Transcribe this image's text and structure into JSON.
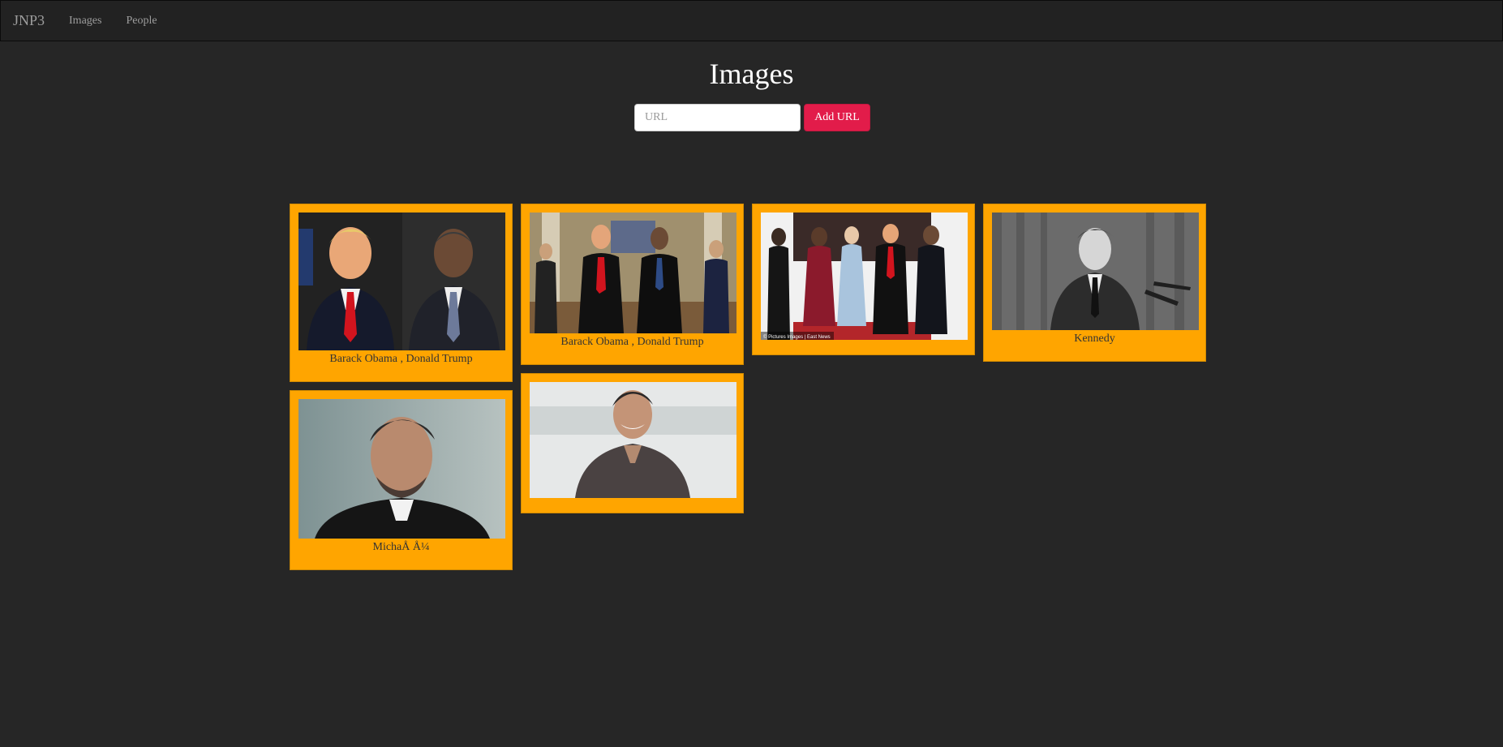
{
  "nav": {
    "brand": "JNP3",
    "links": [
      "Images",
      "People"
    ]
  },
  "page": {
    "title": "Images"
  },
  "form": {
    "placeholder": "URL",
    "button_label": "Add URL"
  },
  "cards": [
    {
      "caption": "Barack Obama , Donald Trump",
      "photo_credit": ""
    },
    {
      "caption": "Barack Obama , Donald Trump",
      "photo_credit": ""
    },
    {
      "caption": "",
      "photo_credit": "© Pictures Images | East News"
    },
    {
      "caption": "Kennedy",
      "photo_credit": ""
    },
    {
      "caption": "MichaÅ Å¼",
      "photo_credit": ""
    },
    {
      "caption": "",
      "photo_credit": ""
    }
  ],
  "colors": {
    "background": "#262626",
    "navbar": "#222222",
    "card": "#ffa500",
    "button": "#e21c4a"
  }
}
